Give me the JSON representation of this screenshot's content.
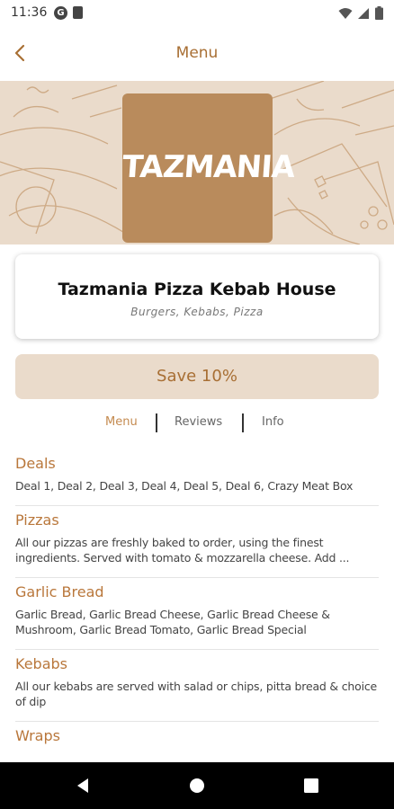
{
  "status_bar": {
    "time": "11:36",
    "icons_left": [
      "g-icon",
      "sim-card-icon"
    ],
    "icons_right": [
      "wifi-icon",
      "signal-icon",
      "battery-icon"
    ]
  },
  "header": {
    "title": "Menu",
    "back_icon": "chevron-left-icon"
  },
  "banner": {
    "logo_text": "TAZMANIA"
  },
  "restaurant": {
    "name": "Tazmania Pizza Kebab House",
    "cuisines": "Burgers, Kebabs, Pizza"
  },
  "offer": {
    "label": "Save 10%"
  },
  "tabs": [
    {
      "label": "Menu",
      "active": true
    },
    {
      "label": "Reviews",
      "active": false
    },
    {
      "label": "Info",
      "active": false
    }
  ],
  "menu_categories": [
    {
      "title": "Deals",
      "description": "Deal 1, Deal 2, Deal 3, Deal 4, Deal 5, Deal 6, Crazy Meat Box"
    },
    {
      "title": "Pizzas",
      "description": "All our pizzas are freshly baked to order, using the finest ingredients. Served with tomato & mozzarella cheese. Add ..."
    },
    {
      "title": "Garlic Bread",
      "description": "Garlic Bread, Garlic Bread Cheese, Garlic Bread Cheese & Mushroom, Garlic Bread Tomato, Garlic Bread Special"
    },
    {
      "title": "Kebabs",
      "description": "All our kebabs are served with salad or chips, pitta bread & choice of dip"
    },
    {
      "title": "Wraps",
      "description": ""
    }
  ],
  "nav_bar": {
    "buttons": [
      "back-triangle-icon",
      "home-circle-icon",
      "recents-square-icon"
    ]
  },
  "colors": {
    "accent": "#a86f34",
    "accent_light": "#c48a4f",
    "banner_bg": "#eadbcb",
    "logo_bg": "#b98b5c"
  }
}
